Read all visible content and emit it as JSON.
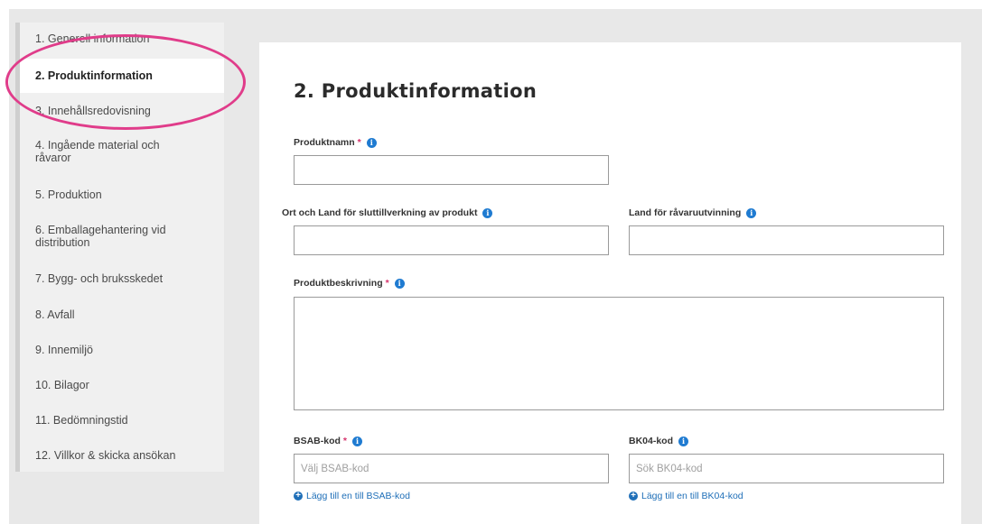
{
  "sidebar": {
    "items": [
      {
        "label": "1. Generell information"
      },
      {
        "label": "2. Produktinformation"
      },
      {
        "label": "3. Innehållsredovisning"
      },
      {
        "label": "4. Ingående material och\nråvaror"
      },
      {
        "label": "5. Produktion"
      },
      {
        "label": "6. Emballagehantering vid\ndistribution"
      },
      {
        "label": "7. Bygg- och bruksskedet"
      },
      {
        "label": "8. Avfall"
      },
      {
        "label": "9. Innemiljö"
      },
      {
        "label": "10. Bilagor"
      },
      {
        "label": "11. Bedömningstid"
      },
      {
        "label": "12. Villkor & skicka ansökan"
      }
    ],
    "active_index": 1
  },
  "main": {
    "title": "2. Produktinformation",
    "fields": {
      "product_name": {
        "label": "Produktnamn",
        "value": ""
      },
      "manufacture_place": {
        "label": "Ort och Land för sluttillverkning av produkt",
        "value": ""
      },
      "raw_material_country": {
        "label": "Land för råvaruutvinning",
        "value": ""
      },
      "description": {
        "label": "Produktbeskrivning",
        "value": ""
      },
      "bsab": {
        "label": "BSAB-kod",
        "placeholder": "Välj BSAB-kod",
        "add_link": "Lägg till en till BSAB-kod"
      },
      "bk04": {
        "label": "BK04-kod",
        "placeholder": "Sök BK04-kod",
        "add_link": "Lägg till en till BK04-kod"
      }
    },
    "required_marker": "*",
    "info_glyph": "i",
    "plus_glyph": "+"
  },
  "colors": {
    "highlight": "#e03c8a",
    "required": "#d6336c",
    "info": "#1f7bd1",
    "link": "#1f6fb8"
  },
  "icons": [
    "info-icon",
    "plus-circle-icon",
    "resize-grip-icon"
  ]
}
